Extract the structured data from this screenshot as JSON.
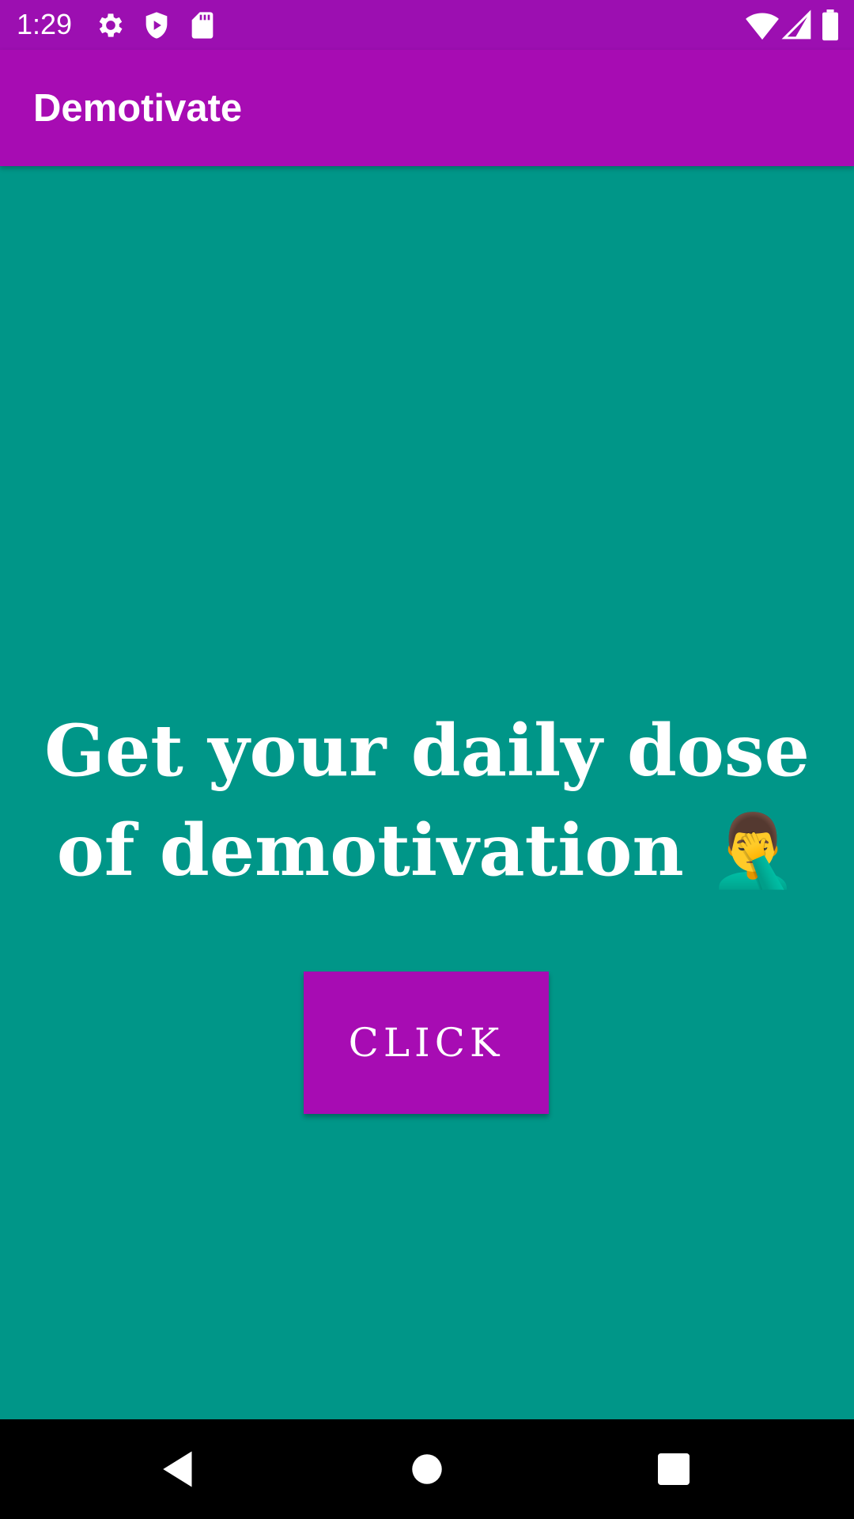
{
  "status_bar": {
    "time": "1:29",
    "icons_left": [
      "gear-icon",
      "shield-play-icon",
      "sd-card-icon"
    ],
    "icons_right": [
      "wifi-icon",
      "cell-signal-icon",
      "battery-icon"
    ]
  },
  "app_bar": {
    "title": "Demotivate"
  },
  "main": {
    "headline": "Get your daily dose of demotivation 🤦‍♂️",
    "button_label": "CLICK"
  },
  "nav_bar": {
    "icons": [
      "back-icon",
      "home-icon",
      "recents-icon"
    ]
  },
  "colors": {
    "status_bar": "#9C0FB1",
    "app_bar": "#A70CB3",
    "background": "#009688",
    "button": "#A70CB3",
    "nav_bar": "#000000",
    "text": "#FFFFFF"
  }
}
